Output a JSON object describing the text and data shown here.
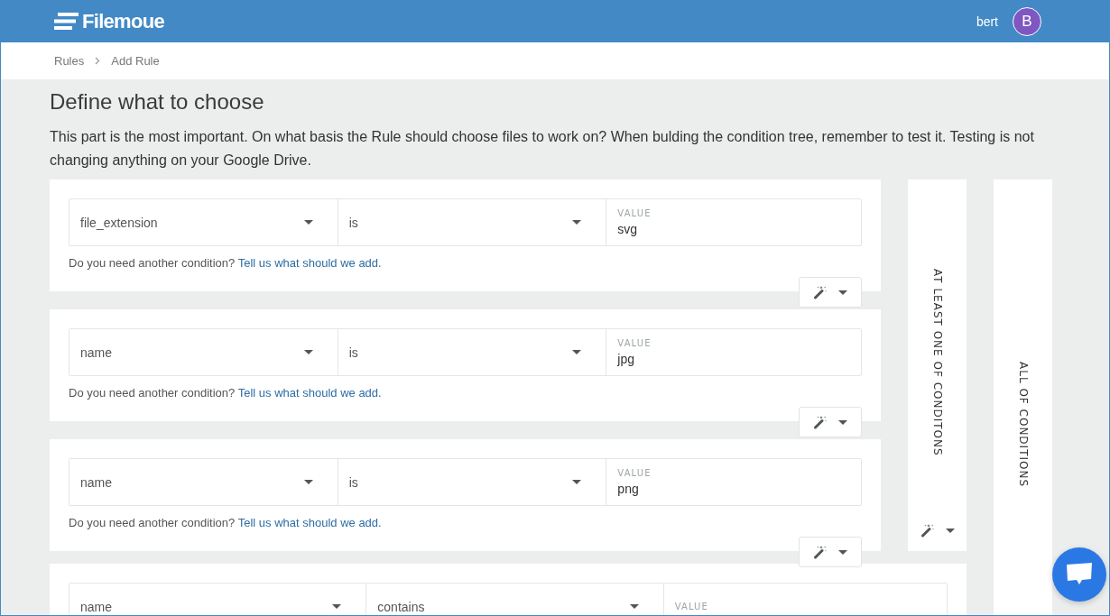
{
  "header": {
    "logo": "Filemoue",
    "user_name": "bert",
    "avatar_initial": "B"
  },
  "breadcrumb": [
    {
      "label": "Rules"
    },
    {
      "label": "Add Rule"
    }
  ],
  "page": {
    "title": "Define what to choose",
    "description": "This part is the most important. On what basis the Rule should choose files to work on? When bulding the condition tree, remember to test it. Testing is not changing anything on your Google Drive."
  },
  "rule_tree": {
    "kind": "group",
    "label": "ALL OF CONDITIONS",
    "children": [
      {
        "kind": "group",
        "label": "AT LEAST ONE OF CONDITONS",
        "children": [
          {
            "kind": "condition",
            "field": "file_extension",
            "operator": "is",
            "value_label": "VALUE",
            "value": "svg",
            "help_text": "Do you need another condition?",
            "help_link": "Tell us what should we add."
          },
          {
            "kind": "condition",
            "field": "name",
            "operator": "is",
            "value_label": "VALUE",
            "value": "jpg",
            "help_text": "Do you need another condition?",
            "help_link": "Tell us what should we add."
          },
          {
            "kind": "condition",
            "field": "name",
            "operator": "is",
            "value_label": "VALUE",
            "value": "png",
            "help_text": "Do you need another condition?",
            "help_link": "Tell us what should we add."
          }
        ]
      },
      {
        "kind": "condition",
        "field": "name",
        "operator": "contains",
        "value_label": "VALUE"
      }
    ]
  }
}
